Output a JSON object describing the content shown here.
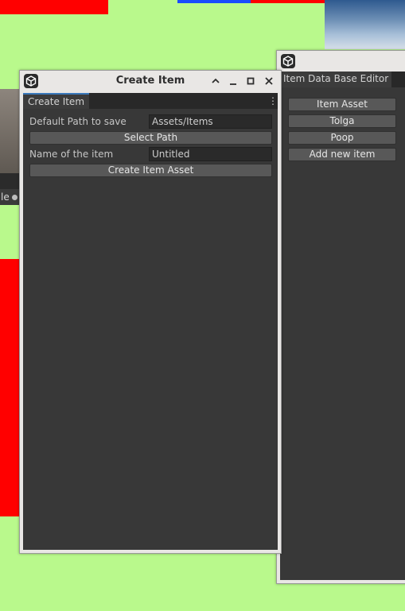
{
  "create_item_window": {
    "title": "Create Item",
    "tab": "Create Item",
    "default_path_label": "Default Path to save",
    "default_path_value": "Assets/Items",
    "select_path_button": "Select Path",
    "name_label": "Name of the item",
    "name_value": "Untitled",
    "create_button": "Create Item Asset"
  },
  "db_window": {
    "tab": "Item Data Base Editor",
    "items": [
      "Item Asset",
      "Tolga",
      "Poop",
      "Add new item"
    ]
  },
  "background": {
    "partial_label": "le"
  },
  "colors": {
    "desktop": "#b9f98c",
    "accent_red": "#ff0000",
    "accent_blue": "#1a4cff",
    "panel": "#383838",
    "tab_highlight": "#3a79bb"
  },
  "icons": [
    "unity-logo-icon",
    "chevron-up-icon",
    "minimize-icon",
    "maximize-icon",
    "close-icon",
    "kebab-menu-icon"
  ]
}
